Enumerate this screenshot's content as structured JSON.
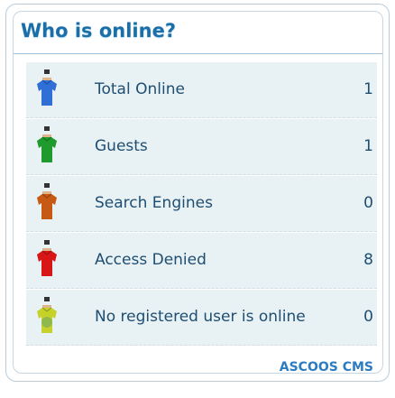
{
  "widget": {
    "title": "Who is online?",
    "rows": [
      {
        "label": "Total Online",
        "count": "1",
        "icon": "user-blue-icon",
        "color": "#2f6fd6"
      },
      {
        "label": "Guests",
        "count": "1",
        "icon": "user-green-icon",
        "color": "#1f9a2c"
      },
      {
        "label": "Search Engines",
        "count": "0",
        "icon": "user-orange-icon",
        "color": "#c65a14"
      },
      {
        "label": "Access Denied",
        "count": "8",
        "icon": "user-red-icon",
        "color": "#d81616"
      },
      {
        "label": "No registered user is online",
        "count": "0",
        "icon": "user-yellow-icon",
        "color": "#c6d22a"
      }
    ],
    "footer_link": "ASCOOS CMS"
  }
}
